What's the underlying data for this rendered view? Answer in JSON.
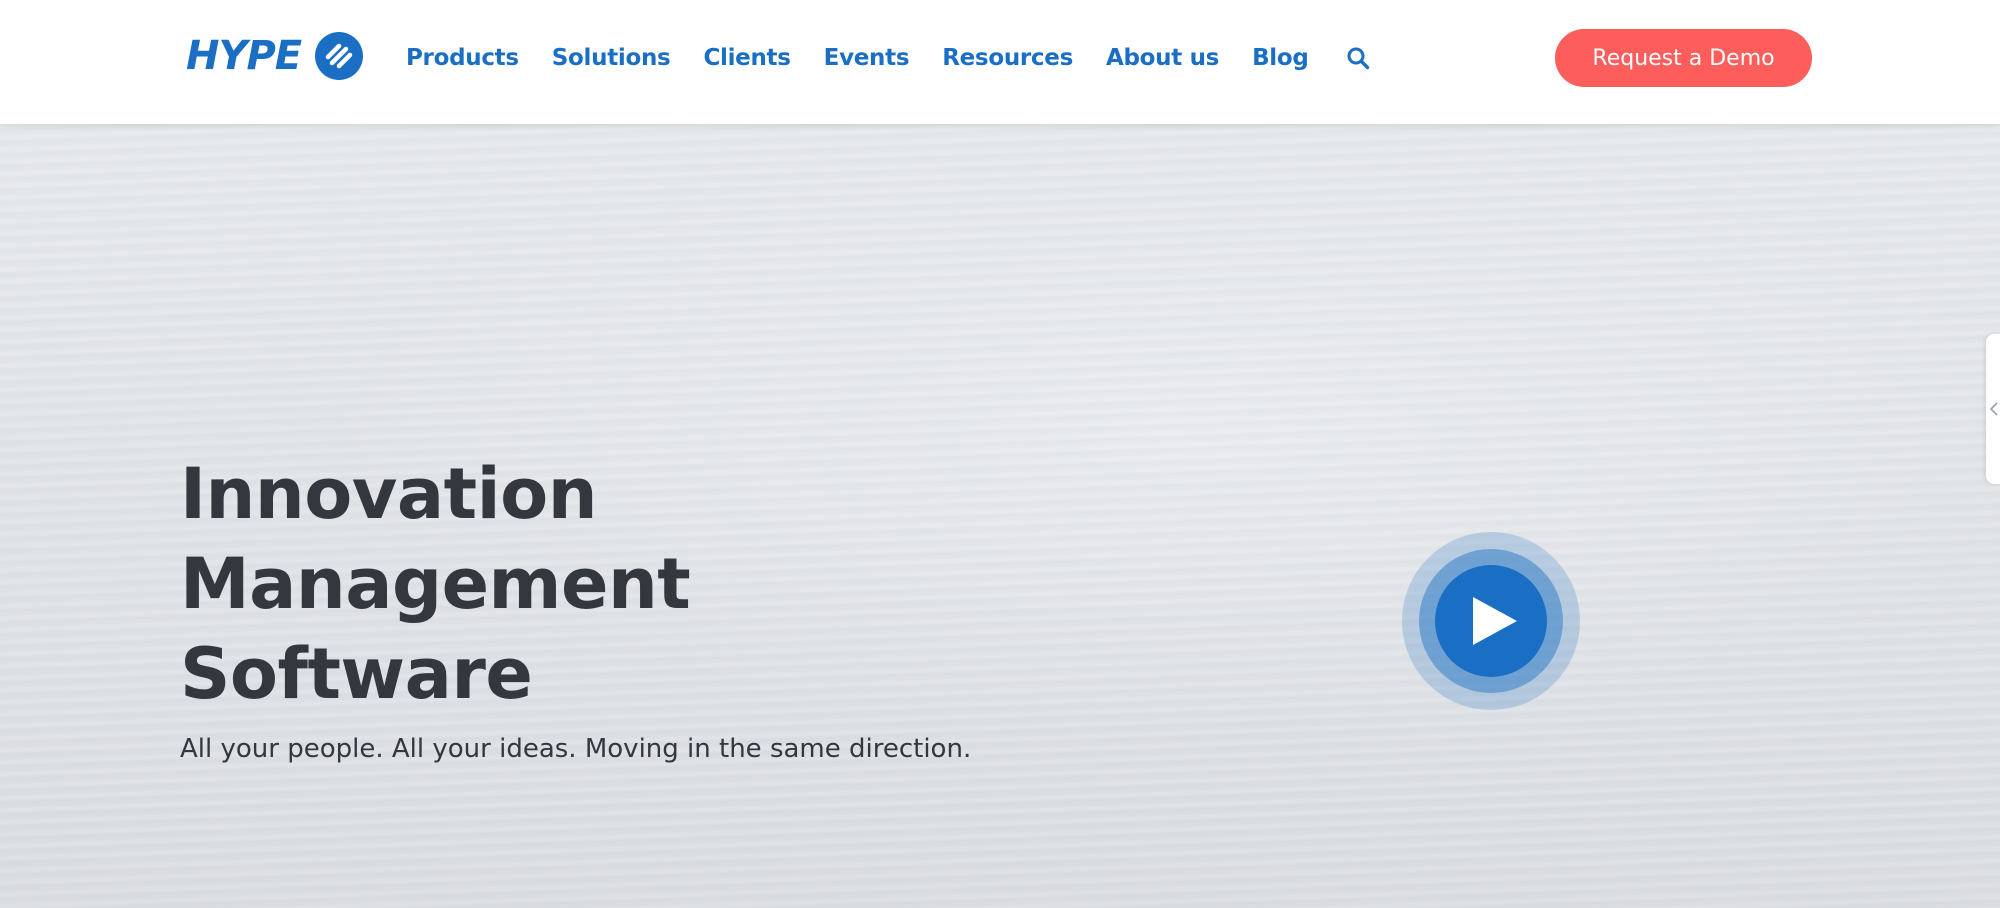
{
  "header": {
    "logo_text": "HYPE",
    "nav": {
      "products": "Products",
      "solutions": "Solutions",
      "clients": "Clients",
      "events": "Events",
      "resources": "Resources",
      "about": "About us",
      "blog": "Blog"
    },
    "search_icon": "search-icon",
    "demo_button": "Request a Demo"
  },
  "hero": {
    "title_line_1": "Innovation",
    "title_line_2": "Management",
    "title_line_3": "Software",
    "subtitle": "All your people. All your ideas. Moving in the same direction.",
    "play_icon": "play-icon"
  },
  "side_tab": {
    "icon": "chevron-left-icon"
  },
  "colors": {
    "brand_blue": "#1a6fc4",
    "cta_red": "#fd5e5c",
    "heading_dark": "#33383f",
    "hero_bg": "#e3e6ea"
  }
}
